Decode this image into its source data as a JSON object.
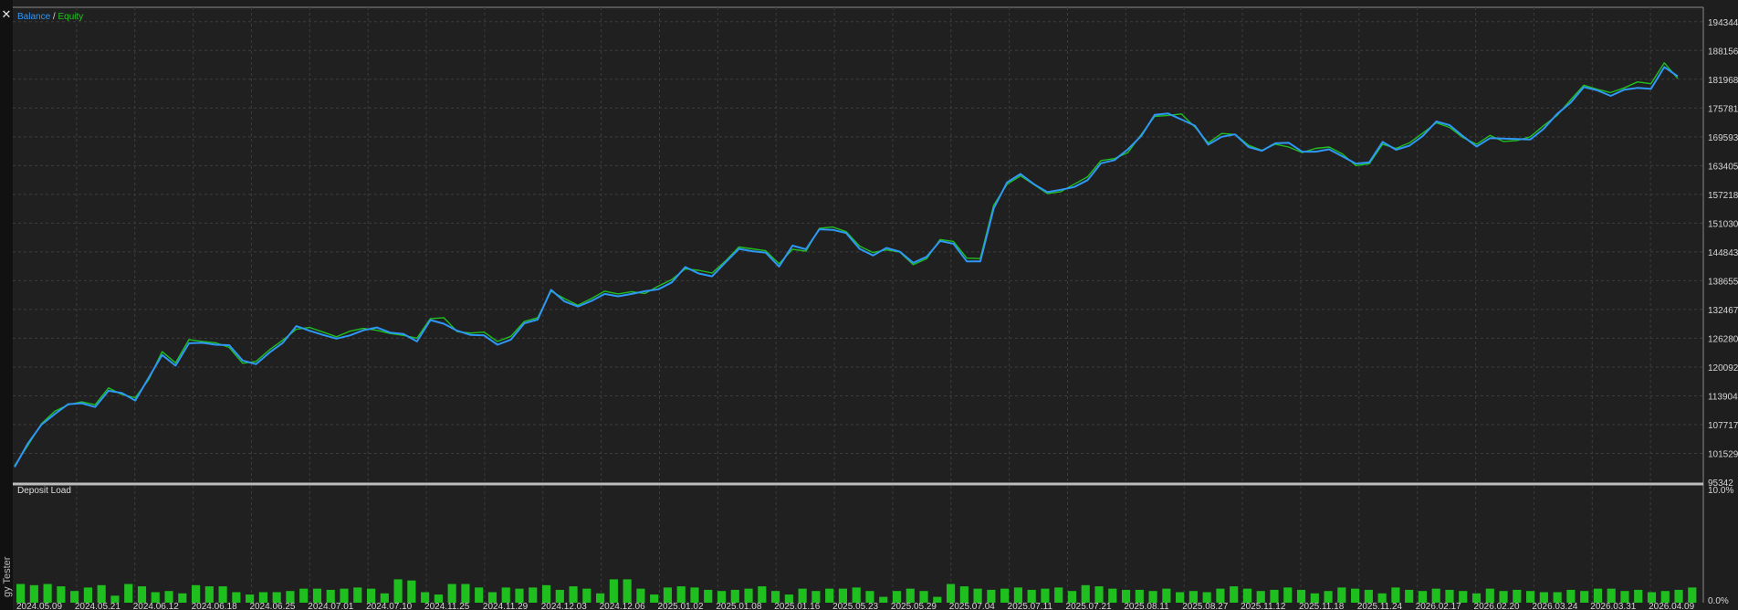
{
  "window": {
    "panel_title": "gy Tester",
    "close_glyph": "✕",
    "close_icon": "close-icon"
  },
  "colors": {
    "background": "#1e1e1e",
    "grid": "#3c3c3c",
    "balance": "#2f97f5",
    "equity": "#1fbf1f",
    "deposit_bar": "#1fbf1f",
    "axis_text": "#d6d6d6"
  },
  "chart_data": [
    {
      "type": "line",
      "legend": [
        "Balance",
        "Equity"
      ],
      "legend_separator": "/",
      "x": [
        "2024.05.09",
        "2024.05.21",
        "2024.06.12",
        "2024.06.18",
        "2024.06.25",
        "2024.07.01",
        "2024.07.10",
        "2024.11.25",
        "2024.11.29",
        "2024.12.03",
        "2024.12.06",
        "2025.01.02",
        "2025.01.08",
        "2025.01.16",
        "2025.05.23",
        "2025.05.29",
        "2025.07.04",
        "2025.07.11",
        "2025.07.21",
        "2025.08.11",
        "2025.08.27",
        "2025.11.12",
        "2025.11.18",
        "2025.11.24",
        "2026.02.17",
        "2026.02.20",
        "2026.03.24",
        "2026.03.31",
        "2026.04.09"
      ],
      "y_ticks": [
        95342,
        101529,
        107717,
        113904,
        120092,
        126280,
        132467,
        138655,
        144843,
        151030,
        157218,
        163405,
        169593,
        175781,
        181968,
        188156,
        194344
      ],
      "ylim": [
        95342,
        197438
      ],
      "grid": true,
      "series": [
        {
          "name": "Balance",
          "values": [
            98600,
            103700,
            107700,
            110000,
            112100,
            112300,
            111500,
            115000,
            114500,
            112900,
            117800,
            122700,
            120400,
            125200,
            125300,
            124900,
            124800,
            121500,
            120700,
            123200,
            125300,
            128900,
            127900,
            127000,
            126200,
            126900,
            128000,
            128600,
            127500,
            127200,
            125600,
            130200,
            129400,
            127900,
            127000,
            126900,
            124900,
            126000,
            129500,
            130300,
            136700,
            134200,
            133100,
            134300,
            135800,
            135300,
            135800,
            136400,
            136800,
            138300,
            141600,
            140200,
            139600,
            142600,
            145500,
            145000,
            144700,
            141700,
            146200,
            145400,
            149700,
            149600,
            148900,
            145500,
            144100,
            145700,
            144900,
            142500,
            143800,
            147200,
            146600,
            142800,
            142800,
            154200,
            159800,
            161600,
            159400,
            157700,
            158200,
            158800,
            160300,
            163900,
            164600,
            166900,
            169800,
            174300,
            174600,
            173300,
            172000,
            167900,
            169600,
            170100,
            167400,
            166600,
            168200,
            168300,
            166400,
            166400,
            166900,
            165400,
            163800,
            164100,
            168500,
            166800,
            167700,
            169800,
            172900,
            172100,
            169700,
            167500,
            169300,
            169200,
            169100,
            169000,
            171300,
            174500,
            176900,
            180300,
            179600,
            178400,
            179700,
            180100,
            179900,
            184600,
            182600
          ],
          "source": "read off the drawn line"
        },
        {
          "name": "Equity",
          "values": [
            98900,
            103300,
            107900,
            110600,
            112000,
            112600,
            112000,
            115600,
            114200,
            113500,
            117400,
            123400,
            121000,
            126000,
            125600,
            125300,
            124300,
            120900,
            121300,
            123800,
            125900,
            128200,
            128600,
            127600,
            126600,
            127800,
            128400,
            128000,
            127300,
            126900,
            126300,
            130500,
            130700,
            127700,
            127400,
            127600,
            125600,
            126700,
            129900,
            130700,
            136400,
            134800,
            133400,
            134800,
            136400,
            135800,
            136300,
            135900,
            137500,
            138900,
            141200,
            140900,
            140300,
            142900,
            145900,
            145500,
            145100,
            142300,
            145400,
            145000,
            149900,
            150200,
            149200,
            146100,
            144700,
            145300,
            144800,
            142100,
            143400,
            147500,
            147100,
            143500,
            143400,
            154900,
            159400,
            161200,
            159300,
            157400,
            157800,
            159400,
            161000,
            164500,
            164900,
            166200,
            170100,
            174000,
            174200,
            174500,
            171700,
            168300,
            170300,
            170100,
            167800,
            166700,
            168000,
            167400,
            166200,
            167100,
            167400,
            165900,
            163400,
            163800,
            168000,
            167100,
            168300,
            170400,
            172600,
            171600,
            169400,
            168000,
            169900,
            168600,
            168800,
            169600,
            172000,
            174200,
            177500,
            180700,
            179800,
            179100,
            180100,
            181400,
            181000,
            185500,
            182100
          ]
        }
      ]
    },
    {
      "type": "bar",
      "title": "Deposit Load",
      "y_ticks": [
        "10.0%",
        "0.0%"
      ],
      "ylim": [
        0,
        10
      ],
      "values": [
        1.6,
        1.5,
        1.6,
        1.4,
        1.0,
        1.3,
        1.5,
        0.6,
        1.6,
        1.4,
        0.9,
        1.0,
        0.8,
        1.5,
        1.4,
        1.4,
        0.9,
        0.7,
        0.9,
        0.9,
        1.0,
        1.2,
        1.2,
        1.1,
        1.2,
        1.3,
        1.2,
        0.8,
        2.0,
        1.9,
        0.9,
        0.7,
        1.6,
        1.6,
        1.3,
        0.9,
        1.3,
        1.2,
        1.3,
        1.5,
        1.1,
        1.4,
        1.2,
        0.8,
        2.0,
        2.0,
        1.2,
        0.7,
        1.3,
        1.4,
        1.3,
        1.1,
        1.0,
        1.1,
        1.2,
        1.4,
        1.0,
        0.7,
        1.2,
        1.0,
        1.2,
        1.2,
        1.3,
        1.0,
        0.5,
        1.0,
        1.2,
        1.0,
        0.5,
        1.6,
        1.4,
        1.2,
        1.1,
        1.2,
        1.3,
        1.1,
        1.2,
        1.3,
        1.0,
        1.5,
        1.4,
        1.2,
        1.1,
        1.1,
        1.0,
        1.2,
        0.9,
        1.0,
        0.9,
        1.2,
        1.4,
        1.2,
        1.0,
        1.1,
        1.3,
        1.1,
        0.8,
        1.0,
        1.3,
        1.2,
        1.1,
        0.8,
        1.3,
        1.1,
        1.0,
        1.2,
        1.1,
        1.0,
        0.8,
        1.2,
        1.0,
        1.1,
        1.0,
        0.9,
        0.9,
        1.1,
        1.0,
        1.2,
        1.2,
        1.0,
        1.1,
        0.9,
        1.0,
        1.1,
        1.3
      ]
    }
  ]
}
